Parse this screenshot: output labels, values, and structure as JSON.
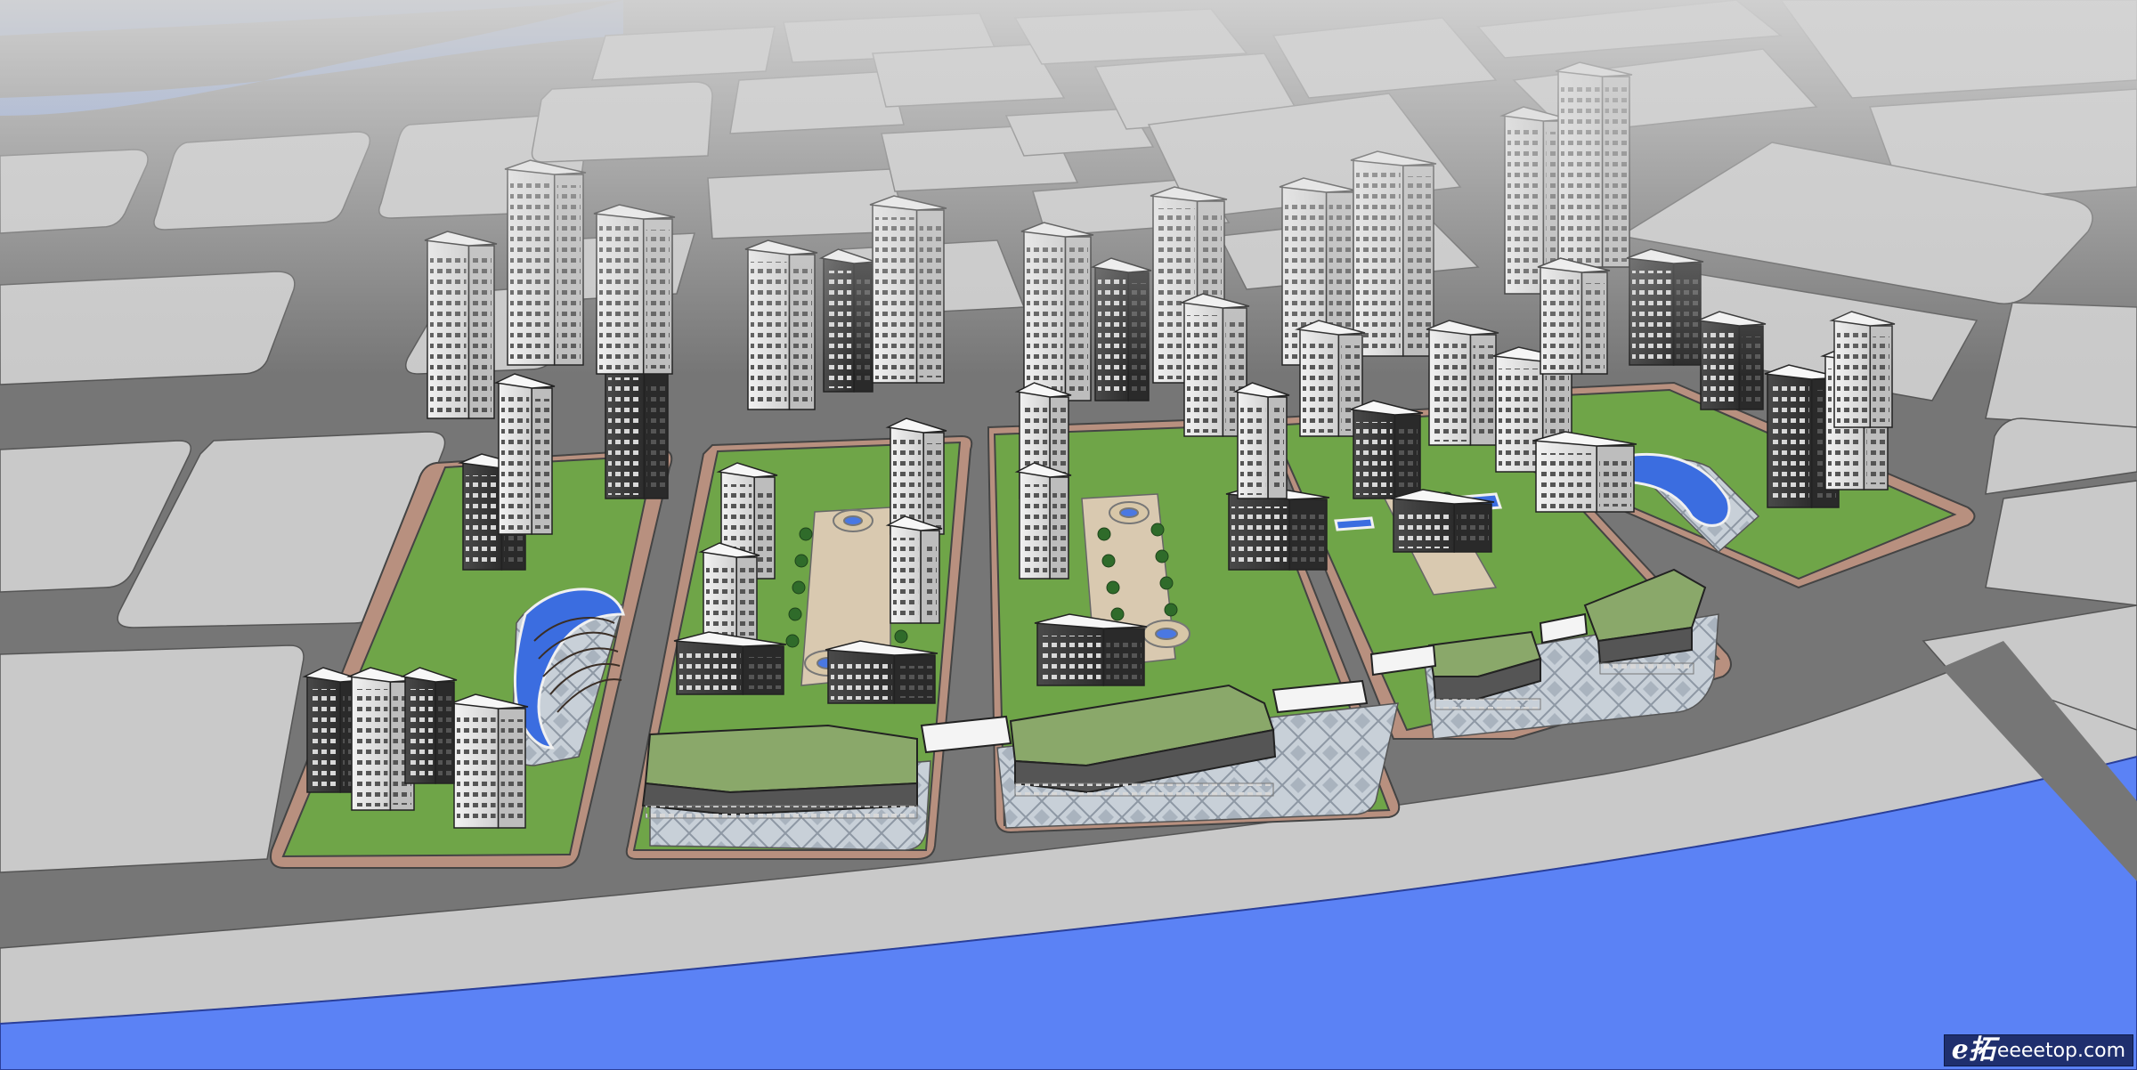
{
  "scene": {
    "kind": "3d-urban-masterplan-rendering",
    "colors": {
      "road": "#767676",
      "block": "#c9c9c9",
      "river": "#5b82f5",
      "upper_river": "#7a97d6",
      "lawn": "#6fa548",
      "plaza": "#bcc4cc",
      "green_roof": "#8aa86a",
      "tower_light": "#e9e9e9",
      "tower_dark": "#3c3c3c"
    }
  },
  "watermark": {
    "logo": "e拓",
    "text": "eeeetop.com"
  }
}
